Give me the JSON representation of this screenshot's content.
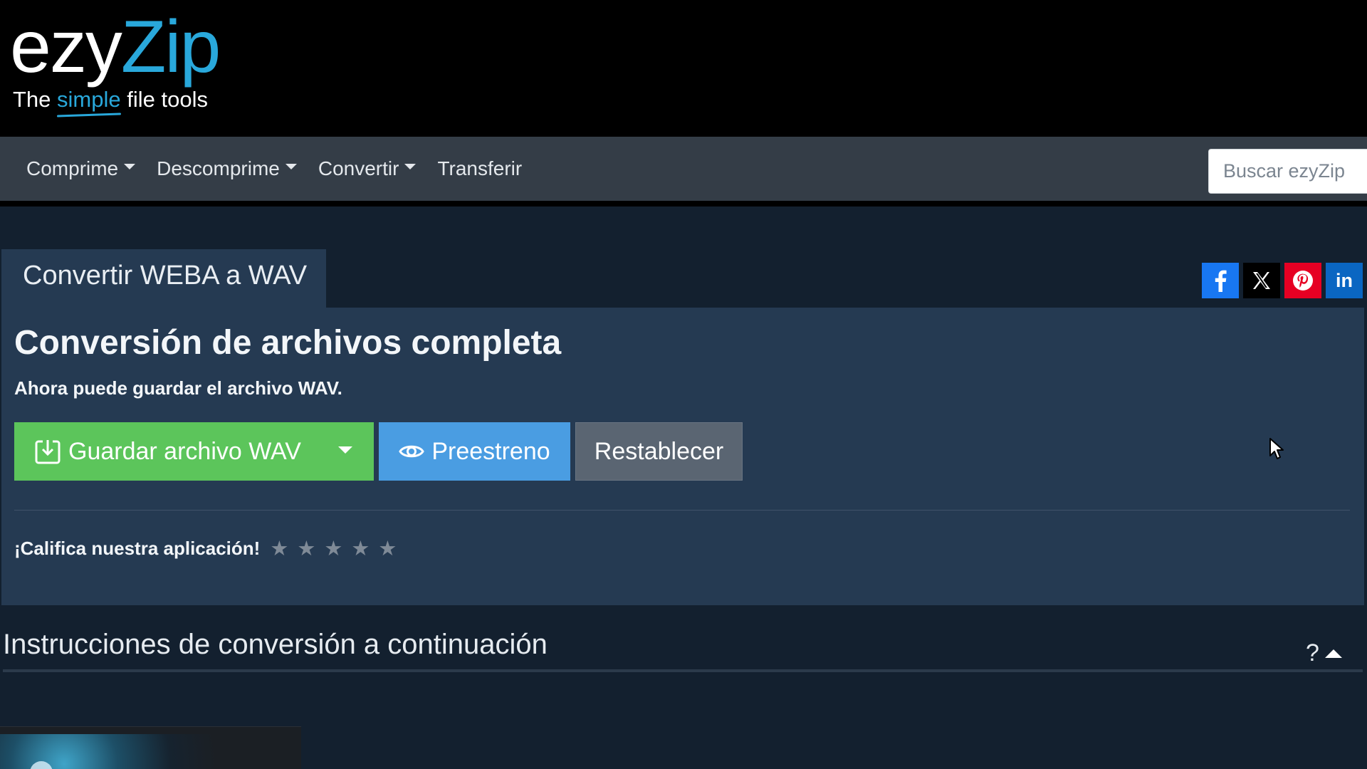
{
  "header": {
    "logo": {
      "brand_part1": "ezy",
      "brand_part2": "Zip",
      "tagline_before": "The",
      "tagline_highlight": "simple",
      "tagline_after": "file tools"
    }
  },
  "nav": {
    "items": [
      {
        "label": "Comprime",
        "has_dropdown": true
      },
      {
        "label": "Descomprime",
        "has_dropdown": true
      },
      {
        "label": "Convertir",
        "has_dropdown": true
      },
      {
        "label": "Transferir",
        "has_dropdown": false
      }
    ],
    "search_placeholder": "Buscar ezyZip"
  },
  "tab": {
    "label": "Convertir WEBA a WAV"
  },
  "social": {
    "icons": [
      "facebook-icon",
      "x-icon",
      "pinterest-icon",
      "linkedin-icon"
    ],
    "linkedin_label": "in"
  },
  "panel": {
    "title": "Conversión de archivos completa",
    "subtitle": "Ahora puede guardar el archivo WAV.",
    "save_button": "Guardar archivo WAV",
    "preview_button": "Preestreno",
    "reset_button": "Restablecer",
    "rating_label": "¡Califica nuestra aplicación!",
    "rating_max": 5,
    "rating_value": 0
  },
  "instructions": {
    "title": "Instrucciones de conversión a continuación",
    "help": "?"
  },
  "colors": {
    "accent": "#29a8db",
    "save": "#5cc55b",
    "preview": "#4a9de2",
    "reset": "#5a6572",
    "panel": "#253a52",
    "navbar": "#343d47"
  }
}
